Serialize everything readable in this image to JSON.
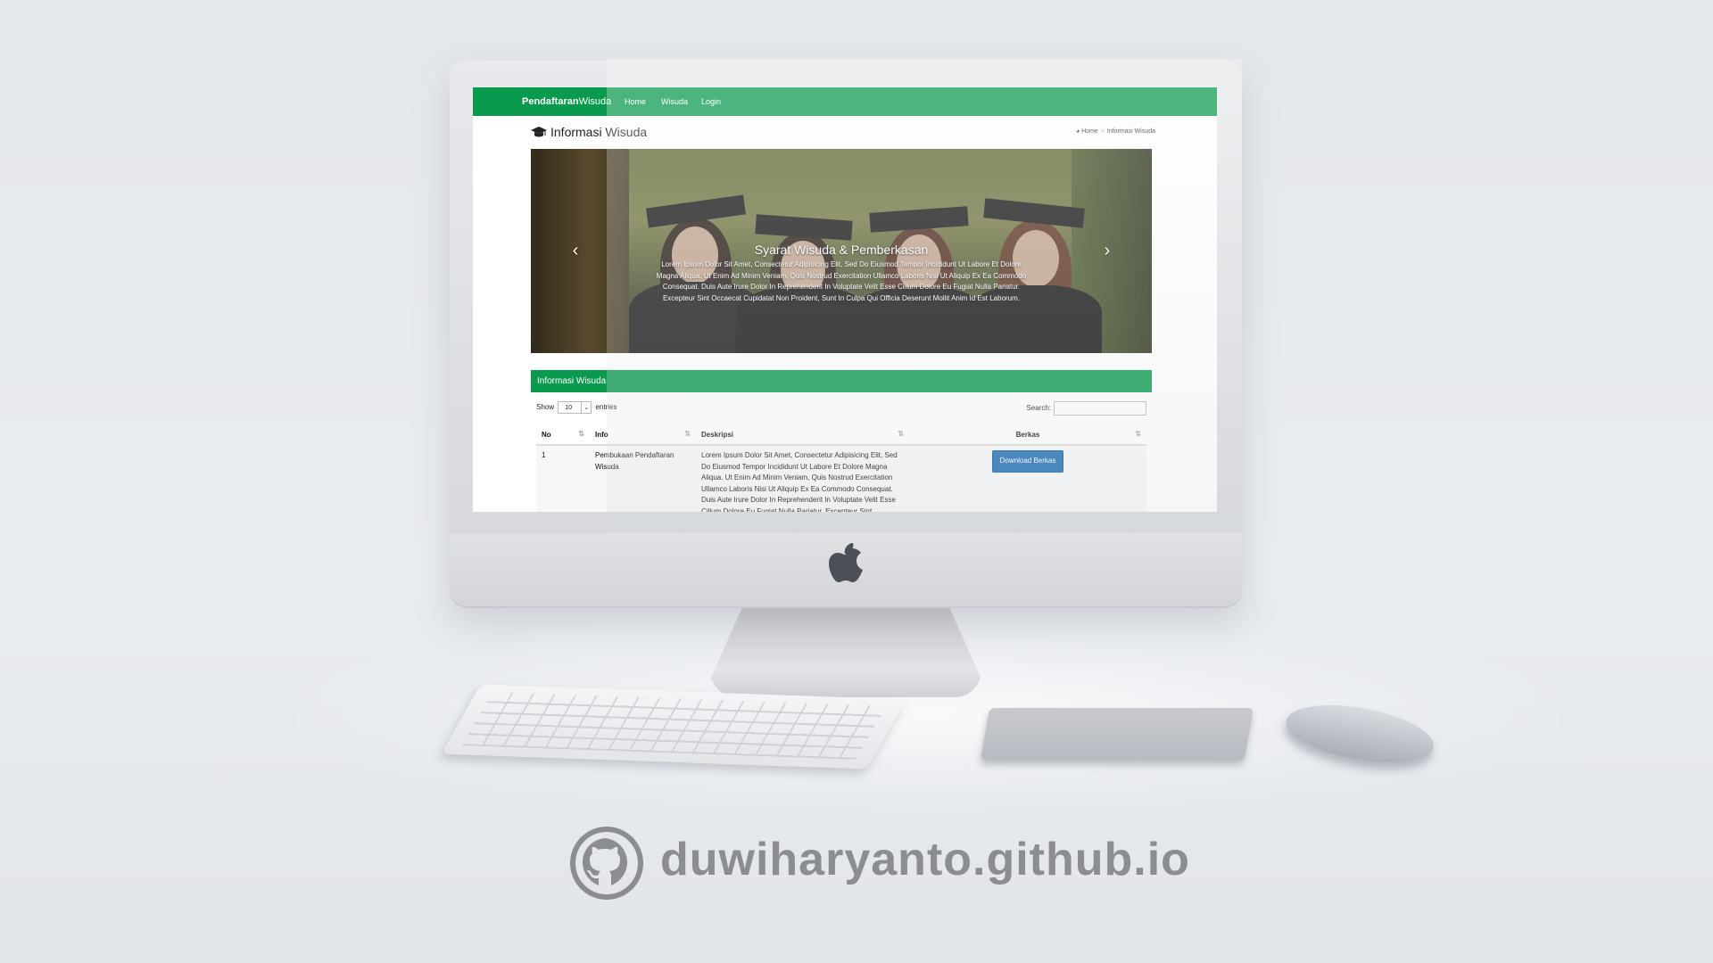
{
  "navbar": {
    "brand_bold": "Pendaftaran",
    "brand_normal": "Wisuda",
    "links": [
      "Home",
      "Wisuda",
      "Login"
    ],
    "color": "#0a9a4d"
  },
  "page": {
    "title": "Informasi Wisuda",
    "title_icon": "graduation-cap-icon",
    "breadcrumb": {
      "home": "Home",
      "current": "Informasi Wisuda",
      "home_icon": "dashboard-icon"
    }
  },
  "carousel": {
    "caption_title": "Syarat Wisuda & Pemberkasan",
    "caption_text": "Lorem Ipsum Dolor Sit Amet, Consectetur Adipisicing Elit, Sed Do Eiusmod Tempor Incididunt Ut Labore Et Dolore Magna Aliqua. Ut Enim Ad Minim Veniam, Quis Nostrud Exercitation Ullamco Laboris Nisi Ut Aliquip Ex Ea Commodo Consequat. Duis Aute Irure Dolor In Reprehenderit In Voluptate Velit Esse Cillum Dolore Eu Fugiat Nulla Pariatur. Excepteur Sint Occaecat Cupidatat Non Proident, Sunt In Culpa Qui Officia Deserunt Mollit Anim Id Est Laborum.",
    "prev_glyph": "‹",
    "next_glyph": "›"
  },
  "panel": {
    "heading": "Informasi Wisuda",
    "length": {
      "show_label": "Show",
      "value": "10",
      "entries_label": "entries"
    },
    "search_label": "Search:",
    "columns": [
      "No",
      "Info",
      "Deskripsi",
      "Berkas"
    ],
    "rows": [
      {
        "no": "1",
        "info": "Pembukaan Pendaftaran Wisuda",
        "deskripsi": "Lorem Ipsum Dolor Sit Amet, Consectetur Adipisicing Elit, Sed Do Eiusmod Tempor Incididunt Ut Labore Et Dolore Magna Aliqua. Ut Enim Ad Minim Veniam, Quis Nostrud Exercitation Ullamco Laboris Nisi Ut Aliquip Ex Ea Commodo Consequat. Duis Aute Irure Dolor In Reprehenderit In Voluptate Velit Esse Cillum Dolore Eu Fugiat Nulla Pariatur. Excepteur Sint Occaecat Cupidatat Non Proident, Sunt In Culpa Qui Officia Deserunt Mollit Anim Id Est Laborum.",
        "button": "Download Berkas"
      }
    ]
  },
  "footer": {
    "text": "duwiharyanto.github.io",
    "icon": "github-icon"
  }
}
